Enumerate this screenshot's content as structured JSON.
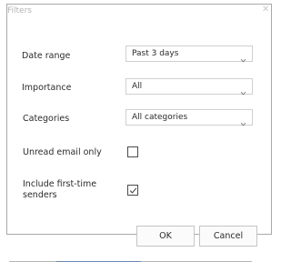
{
  "dialog": {
    "title": "Filters",
    "close_icon": "close-icon"
  },
  "fields": {
    "date_range": {
      "label": "Date range",
      "value": "Past 3 days"
    },
    "importance": {
      "label": "Importance",
      "value": "All"
    },
    "categories": {
      "label": "Categories",
      "value": "All categories"
    },
    "unread_only": {
      "label": "Unread email only",
      "checked": false
    },
    "first_time_senders": {
      "label_line1": "Include  first-time",
      "label_line2": "senders",
      "checked": true
    }
  },
  "buttons": {
    "ok": "OK",
    "cancel": "Cancel"
  },
  "icons": {
    "chevron": "chevron-down-icon",
    "check": "check-icon"
  }
}
